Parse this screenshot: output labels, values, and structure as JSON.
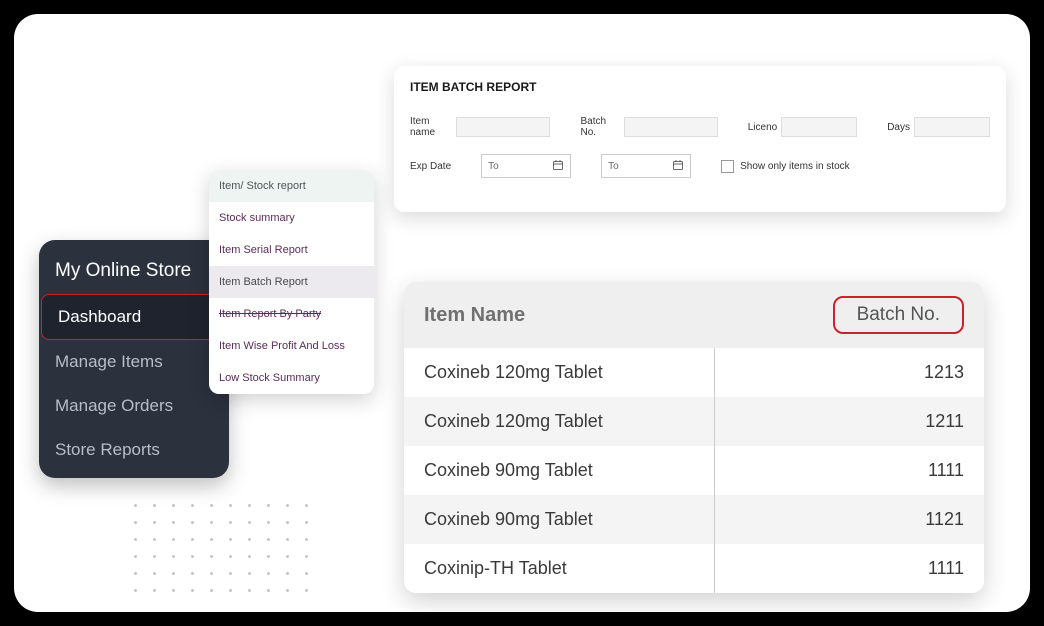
{
  "sidebar": {
    "title": "My Online Store",
    "items": [
      {
        "label": "Dashboard",
        "active": true
      },
      {
        "label": "Manage Items",
        "active": false
      },
      {
        "label": "Manage Orders",
        "active": false
      },
      {
        "label": "Store Reports",
        "active": false
      }
    ]
  },
  "submenu": {
    "header": "Item/ Stock report",
    "items": [
      {
        "label": "Stock summary"
      },
      {
        "label": "Item Serial Report"
      },
      {
        "label": "Item Batch Report",
        "active": true
      },
      {
        "label": "Item Report By Party",
        "struck": true
      },
      {
        "label": "Item Wise Profit And Loss"
      },
      {
        "label": "Low Stock Summary"
      }
    ]
  },
  "report": {
    "title": "ITEM BATCH REPORT",
    "filters": {
      "item_name_label": "Item name",
      "batch_no_label": "Batch No.",
      "liceno_label": "Liceno",
      "days_label": "Days",
      "exp_date_label": "Exp Date",
      "date_from_placeholder": "To",
      "date_to_placeholder": "To",
      "stock_only_label": "Show only items in stock"
    }
  },
  "results": {
    "headers": {
      "item_name": "Item Name",
      "batch_no": "Batch No."
    },
    "rows": [
      {
        "item": "Coxineb 120mg Tablet",
        "batch": "1213"
      },
      {
        "item": "Coxineb 120mg Tablet",
        "batch": "1211"
      },
      {
        "item": "Coxineb 90mg Tablet",
        "batch": "1111"
      },
      {
        "item": "Coxineb 90mg Tablet",
        "batch": "1121"
      },
      {
        "item": "Coxinip-TH Tablet",
        "batch": "1111"
      }
    ]
  }
}
